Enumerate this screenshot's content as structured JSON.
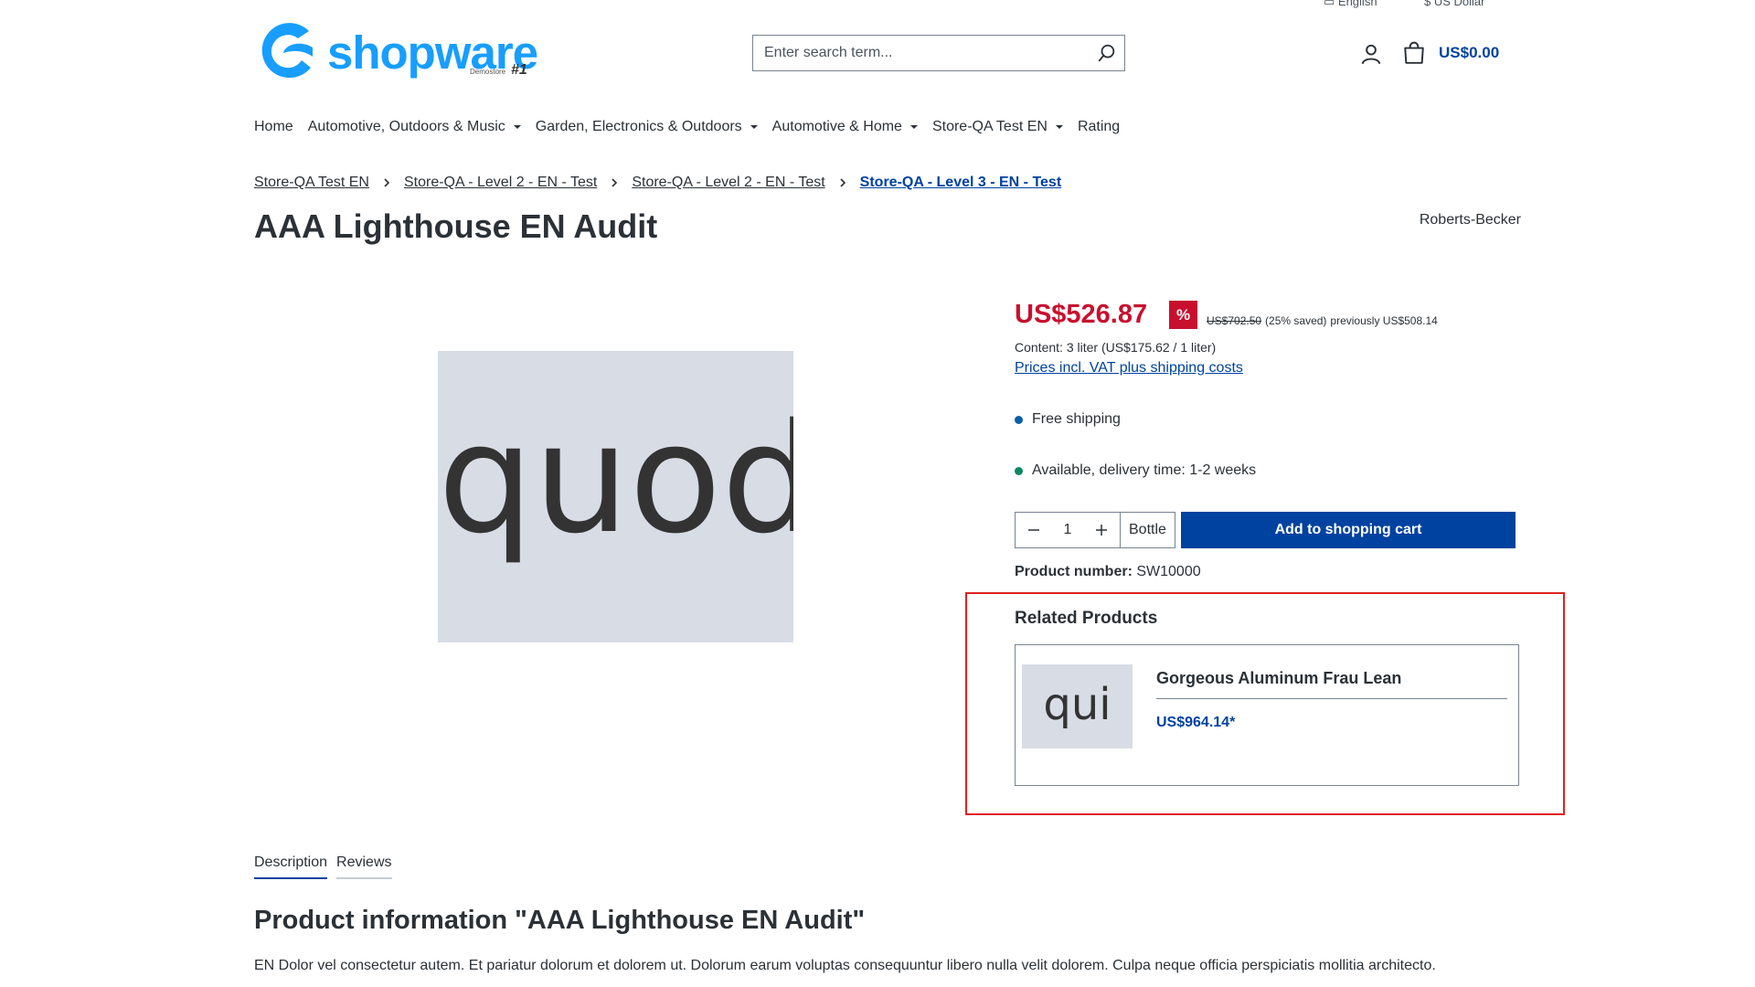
{
  "top_bar": {
    "language": "English",
    "currency": "US Dollar"
  },
  "logo": {
    "word": "shopware",
    "sub": "Demostore",
    "number": "#1"
  },
  "search": {
    "placeholder": "Enter search term..."
  },
  "header": {
    "cart_total": "US$0.00"
  },
  "nav": {
    "items": [
      {
        "label": "Home",
        "dropdown": false
      },
      {
        "label": "Automotive, Outdoors & Music",
        "dropdown": true
      },
      {
        "label": "Garden, Electronics & Outdoors",
        "dropdown": true
      },
      {
        "label": "Automotive & Home",
        "dropdown": true
      },
      {
        "label": "Store-QA Test EN",
        "dropdown": true
      },
      {
        "label": "Rating",
        "dropdown": false
      }
    ]
  },
  "breadcrumb": [
    "Store-QA Test EN",
    "Store-QA - Level 2 - EN - Test",
    "Store-QA - Level 2 - EN - Test",
    "Store-QA - Level 3 - EN - Test"
  ],
  "product": {
    "title": "AAA Lighthouse EN Audit",
    "manufacturer": "Roberts-Becker",
    "image_text": "quod",
    "price": "US$526.87",
    "discount_badge": "%",
    "list_price": "US$702.50",
    "saved": "(25% saved)",
    "previously": "previously US$508.14",
    "content_info": "Content: 3 liter (US$175.62 / 1 liter)",
    "vat_link": "Prices incl. VAT plus shipping costs",
    "free_shipping": "Free shipping",
    "delivery": "Available, delivery time: 1-2 weeks",
    "quantity": "1",
    "unit": "Bottle",
    "add_to_cart": "Add to shopping cart",
    "number_label": "Product number:",
    "number_value": "SW10000"
  },
  "colors": {
    "brand": "#189eff",
    "primary": "#0042a0",
    "sale": "#c8102e",
    "shipping_dot": "#0b5ea8",
    "available_dot": "#0a8a5c",
    "highlight_border": "#e02020"
  },
  "related": {
    "title": "Related Products",
    "items": [
      {
        "thumb_text": "qui",
        "name": "Gorgeous Aluminum Frau Lean",
        "price": "US$964.14*"
      }
    ]
  },
  "tabs": [
    {
      "label": "Description",
      "active": true
    },
    {
      "label": "Reviews",
      "active": false
    }
  ],
  "description": {
    "title": "Product information \"AAA Lighthouse EN Audit\"",
    "text": "EN Dolor vel consectetur autem. Et pariatur dolorum et dolorem ut. Dolorum earum voluptas consequuntur libero nulla velit dolorem. Culpa neque officia perspiciatis mollitia architecto."
  }
}
